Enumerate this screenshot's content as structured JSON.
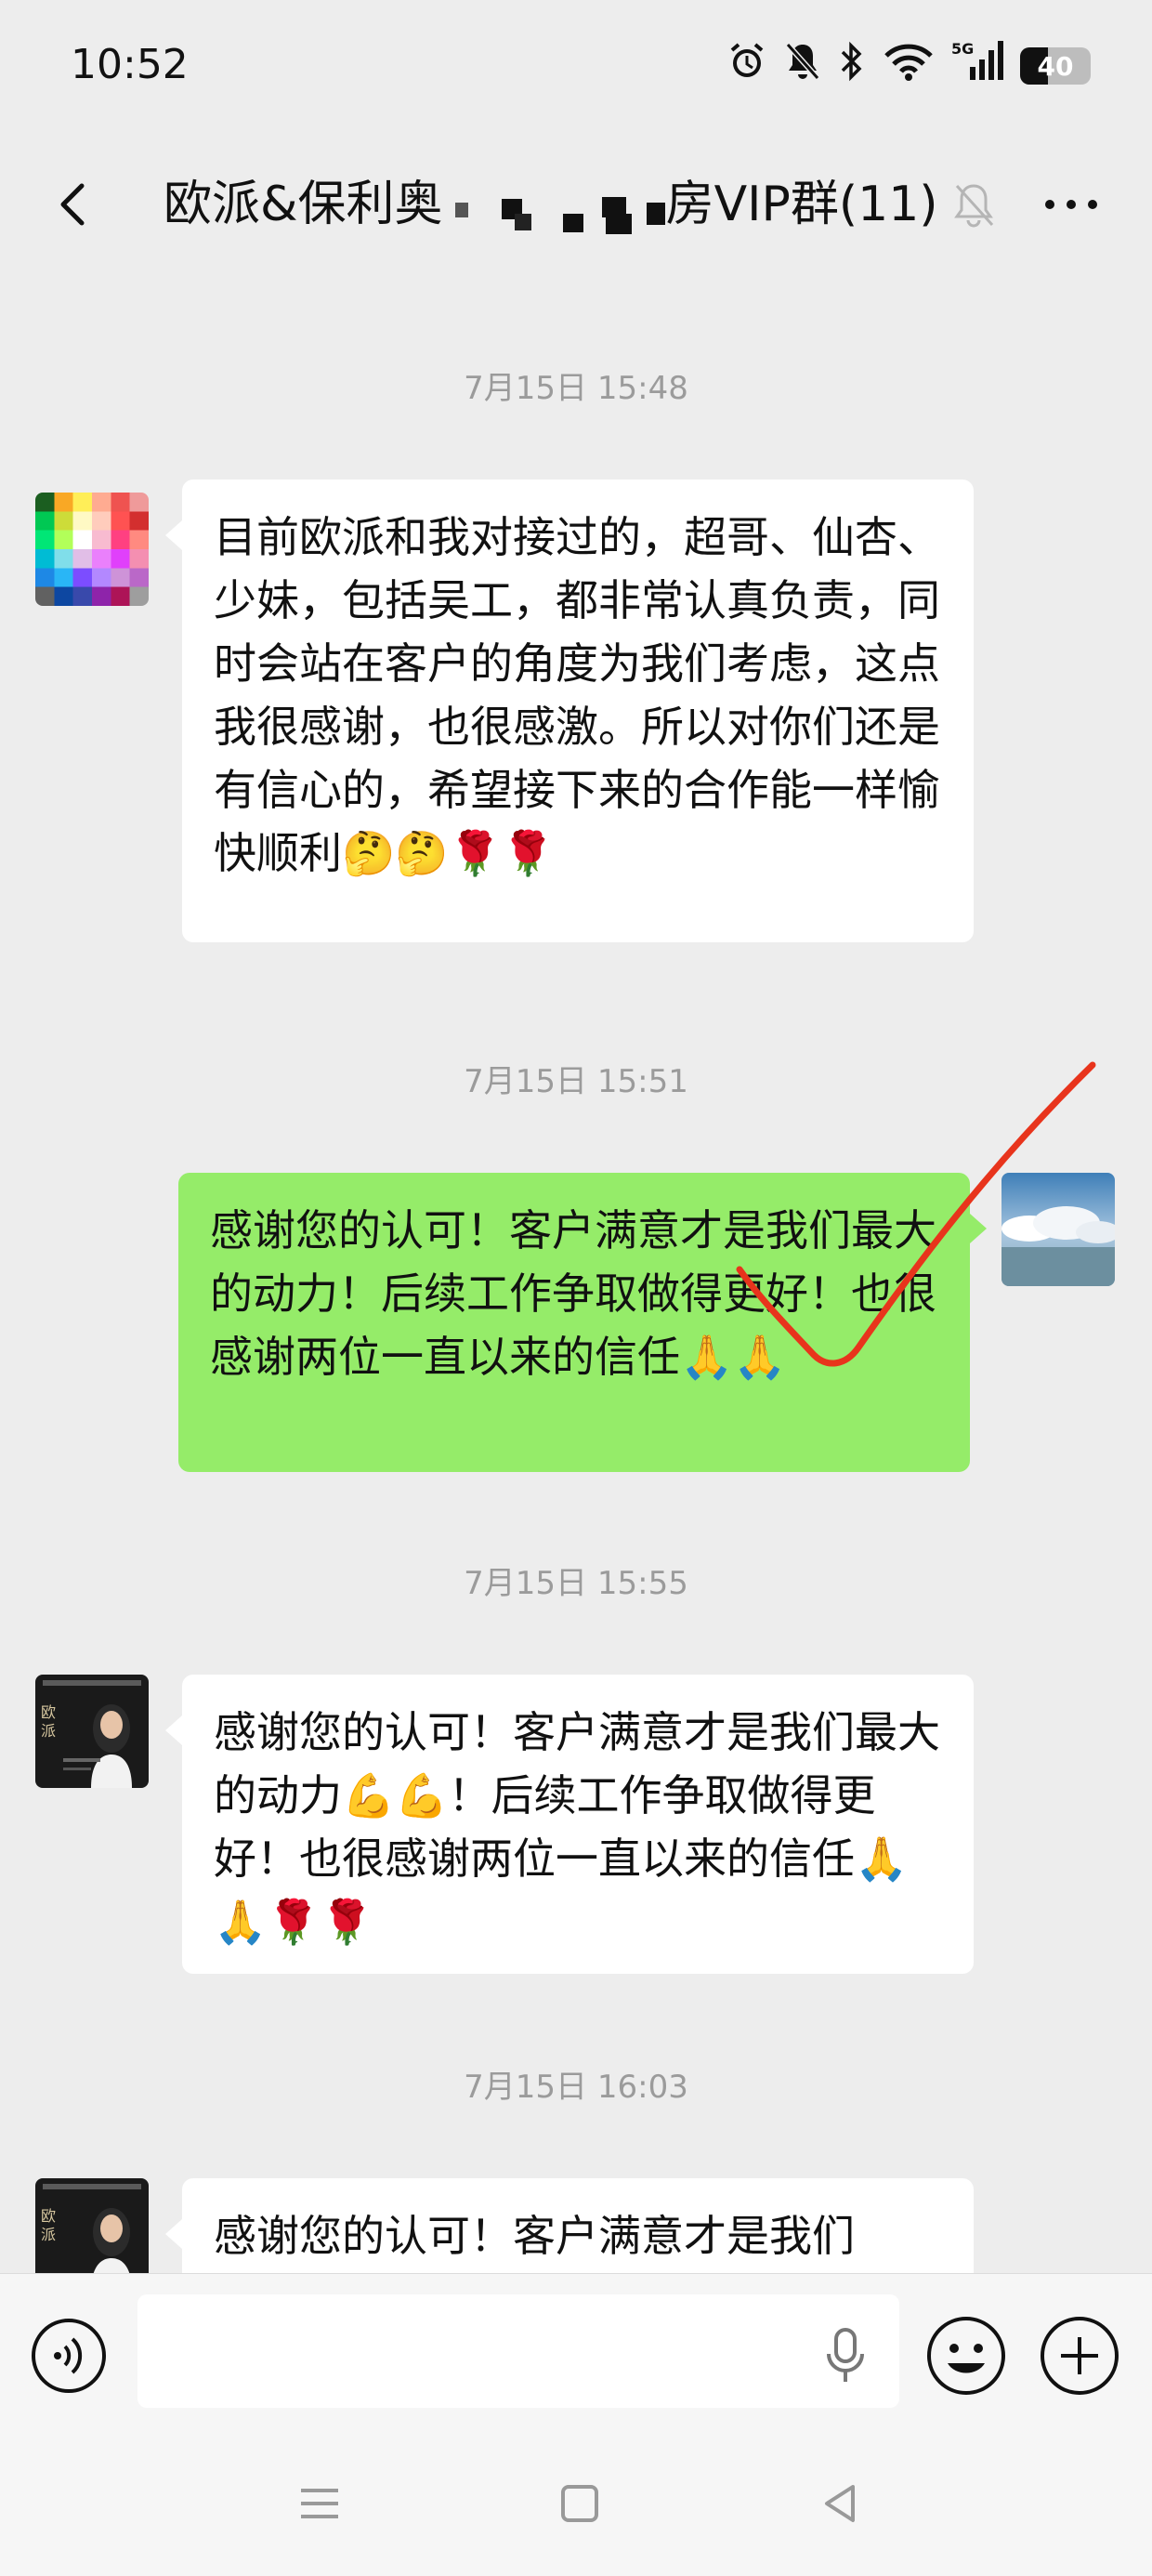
{
  "status_bar": {
    "time": "10:52",
    "network": "5G",
    "battery": "40"
  },
  "header": {
    "chat_title": "欧派&保利奥",
    "chat_title_suffix": "房VIP群(11)"
  },
  "messages": [
    {
      "type": "timestamp",
      "text": "7月15日 15:48"
    },
    {
      "type": "incoming",
      "avatar": "pixelated-avatar",
      "text": "目前欧派和我对接过的，超哥、仙杏、少妹，包括吴工，都非常认真负责，同时会站在客户的角度为我们考虑，这点我很感谢，也很感激。所以对你们还是有信心的，希望接下来的合作能一样愉快顺利🤔🤔🌹🌹"
    },
    {
      "type": "timestamp",
      "text": "7月15日 15:51"
    },
    {
      "type": "outgoing",
      "avatar": "sky-photo-avatar",
      "text": "感谢您的认可！客户满意才是我们最大的动力！后续工作争取做得更好！也很感谢两位一直以来的信任🙏🙏"
    },
    {
      "type": "timestamp",
      "text": "7月15日 15:55"
    },
    {
      "type": "incoming",
      "avatar": "oppein-poster-avatar",
      "text": "感谢您的认可！客户满意才是我们最大的动力💪💪！后续工作争取做得更好！也很感谢两位一直以来的信任🙏🙏🌹🌹"
    },
    {
      "type": "timestamp",
      "text": "7月15日 16:03"
    },
    {
      "type": "incoming",
      "avatar": "oppein-poster-avatar",
      "text": "感谢您的认可！客户满意才是我们"
    }
  ],
  "input_bar": {
    "message_value": "",
    "icons": [
      "voice-icon",
      "mic-icon",
      "emoji-icon",
      "plus-icon"
    ]
  },
  "nav_bar": {
    "icons": [
      "menu-icon",
      "home-icon",
      "back-icon"
    ]
  },
  "colors": {
    "background": "#ededed",
    "outgoing_bubble": "#95ec69",
    "incoming_bubble": "#ffffff",
    "annotation_check": "#e8341c"
  }
}
